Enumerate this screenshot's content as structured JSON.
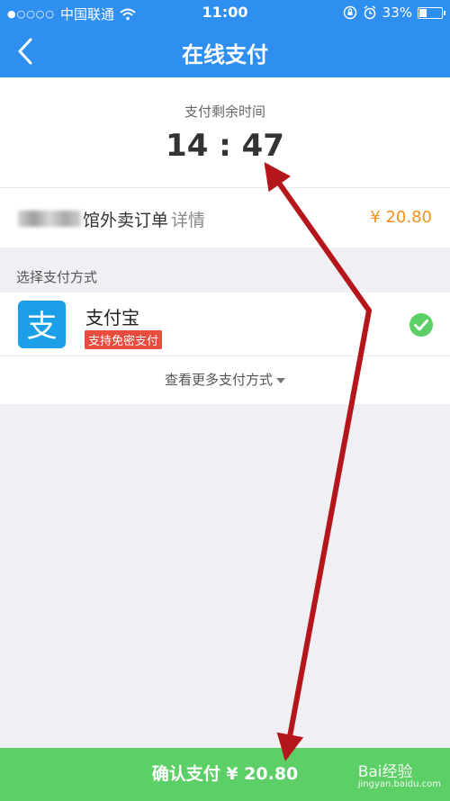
{
  "status_bar": {
    "signal": "●○○○○",
    "carrier": "中国联通",
    "time": "11:00",
    "battery_percent": "33%",
    "battery_level": 0.33
  },
  "nav": {
    "title": "在线支付"
  },
  "timer": {
    "label": "支付剩余时间",
    "value": "14 : 47"
  },
  "order": {
    "name": "馆外卖订单",
    "detail_link": "详情",
    "amount": "¥ 20.80"
  },
  "payment": {
    "section_label": "选择支付方式",
    "methods": [
      {
        "name": "支付宝",
        "badge": "支持免密支付",
        "icon_text": "支",
        "selected": true
      }
    ],
    "more_label": "查看更多支付方式"
  },
  "confirm": {
    "label": "确认支付 ¥ 20.80"
  },
  "watermark": {
    "brand": "Bai经验",
    "url": "jingyan.baidu.com"
  },
  "colors": {
    "header": "#2f8ff0",
    "confirm": "#5ccf66",
    "amount": "#f2911b",
    "badge": "#e74c3c",
    "alipay": "#1a9fe8",
    "check": "#5ccf66",
    "annotation_arrow": "#b5161c"
  },
  "icons": [
    "signal-dots-icon",
    "wifi-icon",
    "orientation-lock-icon",
    "alarm-icon",
    "battery-icon",
    "back-chevron-icon",
    "alipay-logo-icon",
    "check-circle-icon",
    "dropdown-caret-icon",
    "annotation-arrow"
  ]
}
